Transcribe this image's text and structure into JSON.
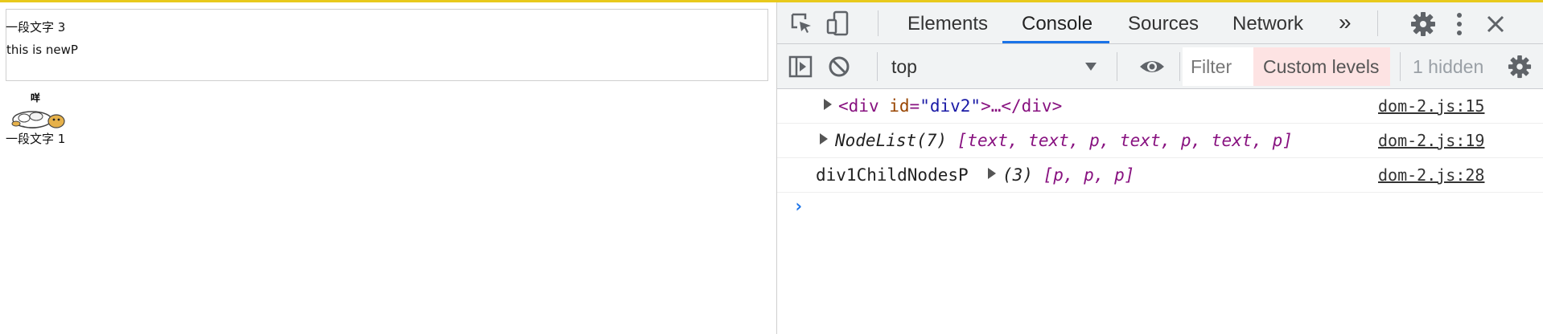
{
  "page": {
    "box_text1": "一段文字 3",
    "box_text2": "this is newP",
    "image_caption": "咩",
    "text_bottom": "一段文字 1"
  },
  "devtools": {
    "tabs": [
      "Elements",
      "Console",
      "Sources",
      "Network"
    ],
    "more_tabs": "»",
    "context": "top",
    "filter_placeholder": "Filter",
    "levels": "Custom levels",
    "hidden_count": "1 hidden"
  },
  "console": {
    "rows": [
      {
        "open": "<",
        "tag": "div",
        "attr": "id",
        "eq": "=",
        "val": "\"div2\"",
        "close": ">…</",
        "tag2": "div",
        "end": ">",
        "source": "dom-2.js:15"
      },
      {
        "type": "NodeList(7)",
        "items": "[text, text, p, text, p, text, p]",
        "source": "dom-2.js:19"
      },
      {
        "label": "div1ChildNodesP",
        "type": "(3)",
        "items": "[p, p, p]",
        "source": "dom-2.js:28"
      }
    ],
    "prompt": "›"
  },
  "colors": {
    "accent": "#1a73e8",
    "highlight_bar": "#e8c91c",
    "levels_bg": "#fde3e3"
  }
}
